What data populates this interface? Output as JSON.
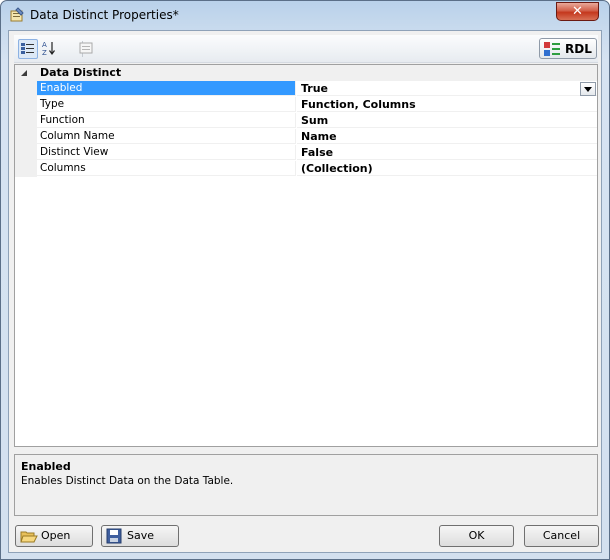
{
  "window": {
    "title": "Data Distinct Properties*",
    "close_label": "✕"
  },
  "toolbar": {
    "categorized_icon": "categorized-icon",
    "alphabetical_icon": "alphabetical-sort-icon",
    "property_pages_icon": "property-pages-icon",
    "rdl_label": "RDL"
  },
  "grid": {
    "category": "Data Distinct",
    "rows": [
      {
        "name": "Enabled",
        "value": "True",
        "selected": true
      },
      {
        "name": "Type",
        "value": "Function, Columns"
      },
      {
        "name": "Function",
        "value": "Sum"
      },
      {
        "name": "Column Name",
        "value": "Name"
      },
      {
        "name": "Distinct View",
        "value": "False"
      },
      {
        "name": "Columns",
        "value": "(Collection)"
      }
    ]
  },
  "help": {
    "title": "Enabled",
    "description": "Enables Distinct Data on the Data Table."
  },
  "buttons": {
    "open": "Open",
    "save": "Save",
    "ok": "OK",
    "cancel": "Cancel"
  },
  "colors": {
    "selection": "#3399ff",
    "close_button": "#c4371d"
  }
}
